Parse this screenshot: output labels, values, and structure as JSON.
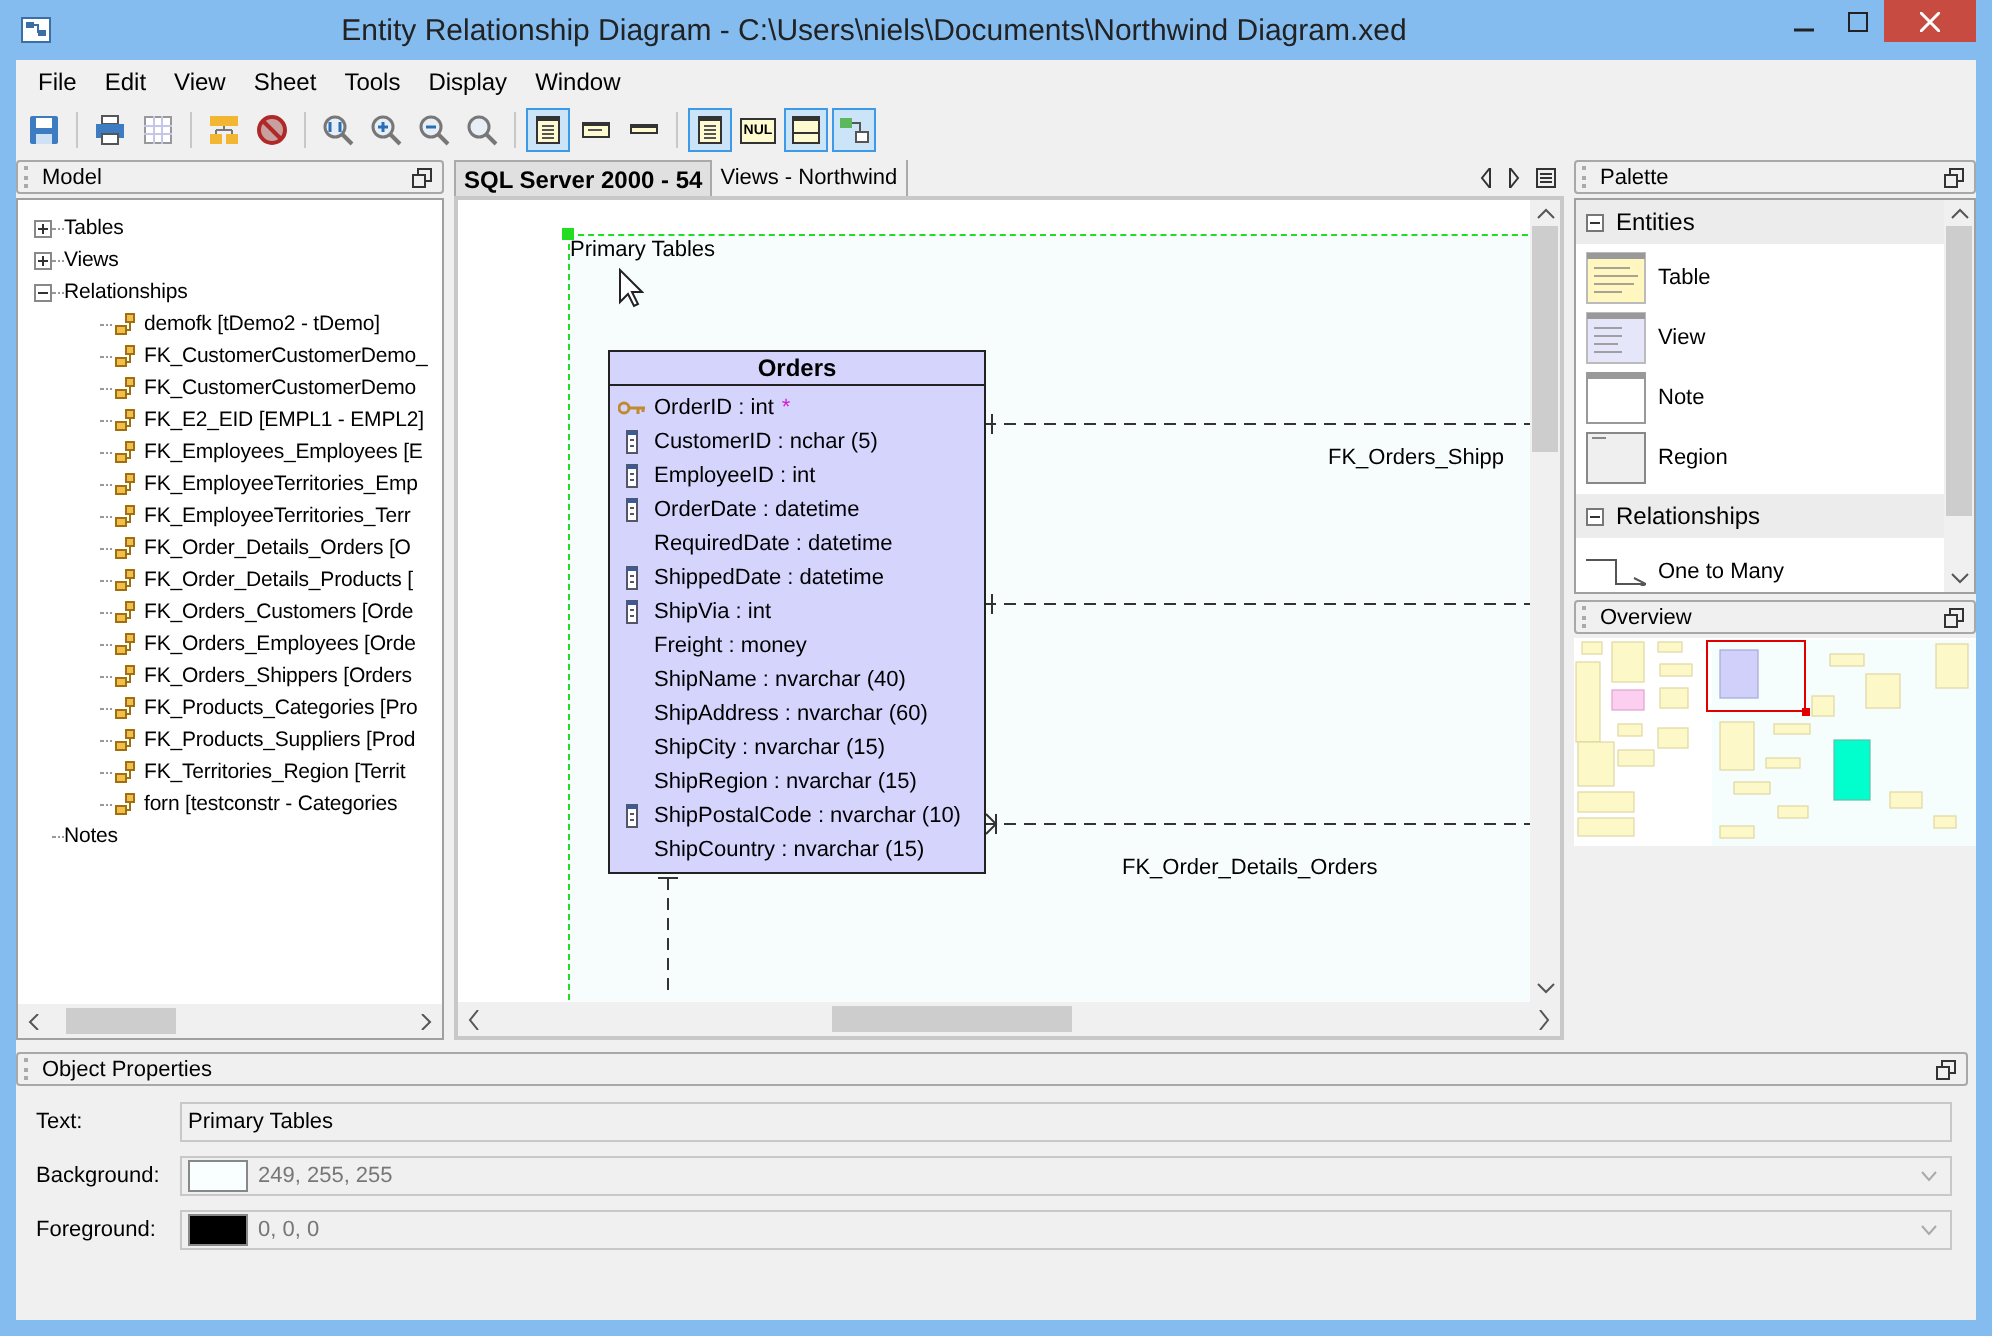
{
  "window": {
    "title": "Entity Relationship Diagram - C:\\Users\\niels\\Documents\\Northwind Diagram.xed"
  },
  "menu": [
    "File",
    "Edit",
    "View",
    "Sheet",
    "Tools",
    "Display",
    "Window"
  ],
  "toolbar": [
    {
      "kind": "save",
      "selected": false
    },
    {
      "kind": "separator"
    },
    {
      "kind": "print",
      "selected": false
    },
    {
      "kind": "grid",
      "selected": false
    },
    {
      "kind": "separator"
    },
    {
      "kind": "hierarchy",
      "selected": false
    },
    {
      "kind": "forbidden",
      "selected": false
    },
    {
      "kind": "separator"
    },
    {
      "kind": "zoom-fit",
      "selected": false
    },
    {
      "kind": "zoom-in",
      "selected": false
    },
    {
      "kind": "zoom-out",
      "selected": false
    },
    {
      "kind": "zoom",
      "selected": false
    },
    {
      "kind": "separator"
    },
    {
      "kind": "table-full",
      "selected": true
    },
    {
      "kind": "table-compact",
      "selected": false
    },
    {
      "kind": "table-header",
      "selected": false
    },
    {
      "kind": "separator"
    },
    {
      "kind": "table-list",
      "selected": true
    },
    {
      "kind": "null",
      "label": "NUL",
      "selected": false
    },
    {
      "kind": "table-split",
      "selected": true
    },
    {
      "kind": "diagram",
      "selected": true
    }
  ],
  "model": {
    "title": "Model",
    "tree": [
      {
        "label": "Tables",
        "expanded": false
      },
      {
        "label": "Views",
        "expanded": false
      },
      {
        "label": "Relationships",
        "expanded": true,
        "children": [
          {
            "label": "demofk [tDemo2 - tDemo]"
          },
          {
            "label": "FK_CustomerCustomerDemo_"
          },
          {
            "label": "FK_CustomerCustomerDemo"
          },
          {
            "label": "FK_E2_EID [EMPL1 - EMPL2]"
          },
          {
            "label": "FK_Employees_Employees [E"
          },
          {
            "label": "FK_EmployeeTerritories_Emp"
          },
          {
            "label": "FK_EmployeeTerritories_Terr"
          },
          {
            "label": "FK_Order_Details_Orders [O"
          },
          {
            "label": "FK_Order_Details_Products ["
          },
          {
            "label": "FK_Orders_Customers [Orde"
          },
          {
            "label": "FK_Orders_Employees [Orde"
          },
          {
            "label": "FK_Orders_Shippers [Orders"
          },
          {
            "label": "FK_Products_Categories [Pro"
          },
          {
            "label": "FK_Products_Suppliers [Prod"
          },
          {
            "label": "FK_Territories_Region [Territ"
          },
          {
            "label": "forn [testconstr - Categories"
          }
        ]
      },
      {
        "label": "Notes"
      }
    ]
  },
  "tabs": [
    {
      "label": "SQL Server 2000 - 54",
      "selected": true
    },
    {
      "label": "Views - Northwind",
      "selected": false
    }
  ],
  "diagram": {
    "region_label": "Primary Tables",
    "table": {
      "name": "Orders",
      "columns": [
        {
          "text": "OrderID : int",
          "kind": "key",
          "marker": "*"
        },
        {
          "text": "CustomerID : nchar (5)",
          "kind": "index"
        },
        {
          "text": "EmployeeID : int",
          "kind": "index"
        },
        {
          "text": "OrderDate : datetime",
          "kind": "index"
        },
        {
          "text": "RequiredDate : datetime",
          "kind": "plain"
        },
        {
          "text": "ShippedDate : datetime",
          "kind": "index"
        },
        {
          "text": "ShipVia : int",
          "kind": "index"
        },
        {
          "text": "Freight : money",
          "kind": "plain"
        },
        {
          "text": "ShipName : nvarchar (40)",
          "kind": "plain"
        },
        {
          "text": "ShipAddress : nvarchar (60)",
          "kind": "plain"
        },
        {
          "text": "ShipCity : nvarchar (15)",
          "kind": "plain"
        },
        {
          "text": "ShipRegion : nvarchar (15)",
          "kind": "plain"
        },
        {
          "text": "ShipPostalCode : nvarchar (10)",
          "kind": "index"
        },
        {
          "text": "ShipCountry : nvarchar (15)",
          "kind": "plain"
        }
      ]
    },
    "relationship_labels": [
      "FK_Orders_Shipp",
      "FK_Order_Details_Orders"
    ]
  },
  "palette": {
    "title": "Palette",
    "groups": [
      {
        "title": "Entities",
        "expanded": true,
        "items": [
          {
            "label": "Table",
            "kind": "table"
          },
          {
            "label": "View",
            "kind": "view"
          },
          {
            "label": "Note",
            "kind": "note"
          },
          {
            "label": "Region",
            "kind": "region"
          }
        ]
      },
      {
        "title": "Relationships",
        "expanded": true,
        "items": [
          {
            "label": "One to Many",
            "kind": "one-to-many"
          }
        ]
      }
    ]
  },
  "overview": {
    "title": "Overview"
  },
  "properties": {
    "title": "Object Properties",
    "fields": [
      {
        "label": "Text:",
        "kind": "text",
        "value": "Primary Tables"
      },
      {
        "label": "Background:",
        "kind": "color",
        "value": "249, 255, 255",
        "color": "#f9ffff"
      },
      {
        "label": "Foreground:",
        "kind": "color",
        "value": "0, 0, 0",
        "color": "#000000"
      }
    ]
  }
}
